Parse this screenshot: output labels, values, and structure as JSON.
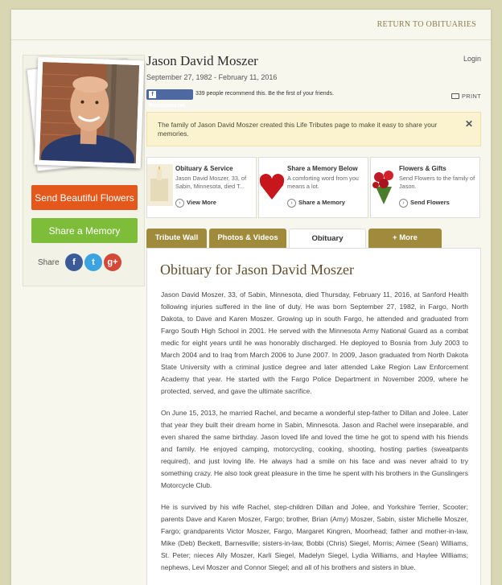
{
  "nav": {
    "return_link": "RETURN TO OBITUARIES",
    "login": "Login"
  },
  "header": {
    "name": "Jason David Moszer",
    "dates": "September 27, 1982 - February 11, 2016",
    "recommend_button": "Recommend",
    "recommend_text": "339 people recommend this. Be the first of your friends.",
    "print_label": "PRINT"
  },
  "sidebar": {
    "send_flowers_label": "Send Beautiful Flowers",
    "share_memory_label": "Share a Memory",
    "share_label": "Share",
    "social": {
      "facebook": "f",
      "twitter": "t",
      "googleplus": "g+"
    }
  },
  "notice": {
    "text": "The family of Jason David Moszer created this Life Tributes page to make it easy to share your memories.",
    "close": "✕"
  },
  "cards": [
    {
      "title": "Obituary & Service",
      "desc": "Jason David Moszer, 33, of Sabin, Minnesota, died T...",
      "action": "View More"
    },
    {
      "title": "Share a Memory Below",
      "desc": "A comforting word from you means a lot.",
      "action": "Share a Memory"
    },
    {
      "title": "Flowers & Gifts",
      "desc": "Send Flowers to the family of Jason.",
      "action": "Send Flowers"
    }
  ],
  "tabs": [
    {
      "label": "Tribute Wall"
    },
    {
      "label": "Photos & Videos"
    },
    {
      "label": "Obituary"
    },
    {
      "label": "+ More"
    }
  ],
  "obituary": {
    "title": "Obituary for Jason David Moszer",
    "paragraphs": [
      "Jason David Moszer, 33, of Sabin, Minnesota, died Thursday, February 11, 2016, at Sanford Health following injuries suffered in the line of duty. He was born September 27, 1982, in Fargo, North Dakota, to Dave and Karen Moszer. Growing up in south Fargo, he attended and graduated from Fargo South High School in 2001. He served with the Minnesota Army National Guard as a combat medic for eight years until he was honorably discharged. He deployed to Bosnia from July 2003 to March 2004 and to Iraq from March 2006 to June 2007. In 2009, Jason graduated from North Dakota State University with a criminal justice degree and later attended Lake Region Law Enforcement Academy that year. He started with the Fargo Police Department in November 2009, where he protected, served, and gave the ultimate sacrifice.",
      "On June 15, 2013, he married Rachel, and became a wonderful step-father to Dillan and Jolee. Later that year they built their dream home in Sabin, Minnesota. Jason and Rachel were inseparable, and even shared the same birthday. Jason loved life and loved the time he got to spend with his friends and family. He enjoyed camping, motorcycling, cooking, shooting, hosting parties (sweatpants required), and just loving life. He always had a smile on his face and was never afraid to try something crazy. He also took great pleasure in the time he spent with his brothers in the Gunslingers Motorcycle Club.",
      "He is survived by his wife Rachel, step-children Dillan and Jolee, and Yorkshire Terrier, Scooter; parents Dave and Karen Moszer, Fargo; brother, Brian (Amy) Moszer, Sabin, sister Michelle Moszer, Fargo; grandparents Victor Moszer, Fargo, Margaret Kingren, Moorhead; father and mother-in-law, Mike (Deb) Beckett, Barnesville; sisters-in-law, Bobbi (Chris) Siegel, Morris; Aimee (Sean) Williams, St. Peter; nieces Ally Moszer, Karli Siegel, Madelyn Siegel, Lydia Williams, and Haylee Williams; nephews, Levi Moszer and Connor Siegel; and all of his brothers and sisters in blue."
    ]
  },
  "colors": {
    "background": "#d9d6b4",
    "flowers_button": "#e4591b",
    "memory_button": "#7dbd3a",
    "tab": "#a08a3c",
    "notice_bg": "#fbf3cf"
  }
}
